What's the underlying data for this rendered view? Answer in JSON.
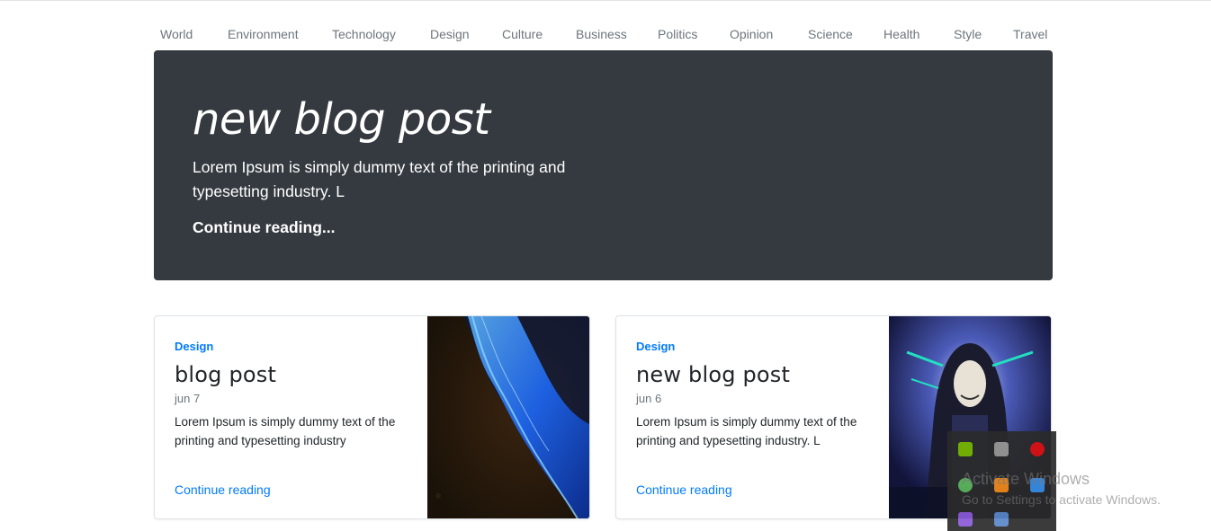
{
  "nav": {
    "items": [
      "World",
      "Environment",
      "Technology",
      "Design",
      "Culture",
      "Business",
      "Politics",
      "Opinion",
      "Science",
      "Health",
      "Style",
      "Travel"
    ]
  },
  "jumbotron": {
    "title": "new blog post",
    "lead": "Lorem Ipsum is simply dummy text of the printing and typesetting industry. L",
    "link": "Continue reading..."
  },
  "cards": [
    {
      "category": "Design",
      "title": "blog post",
      "date": "jun 7",
      "text": "Lorem Ipsum is simply dummy text of the printing and typesetting industry",
      "link": "Continue reading"
    },
    {
      "category": "Design",
      "title": "new blog post",
      "date": "jun 6",
      "text": "Lorem Ipsum is simply dummy text of the printing and typesetting industry. L",
      "link": "Continue reading"
    }
  ],
  "overlay": {
    "watermark_title": "Activate Windows",
    "watermark_sub": "Go to Settings to activate Windows."
  },
  "colors": {
    "accent": "#007bff",
    "jumbotron_bg": "#343a40",
    "nav_text": "#6c757d"
  }
}
